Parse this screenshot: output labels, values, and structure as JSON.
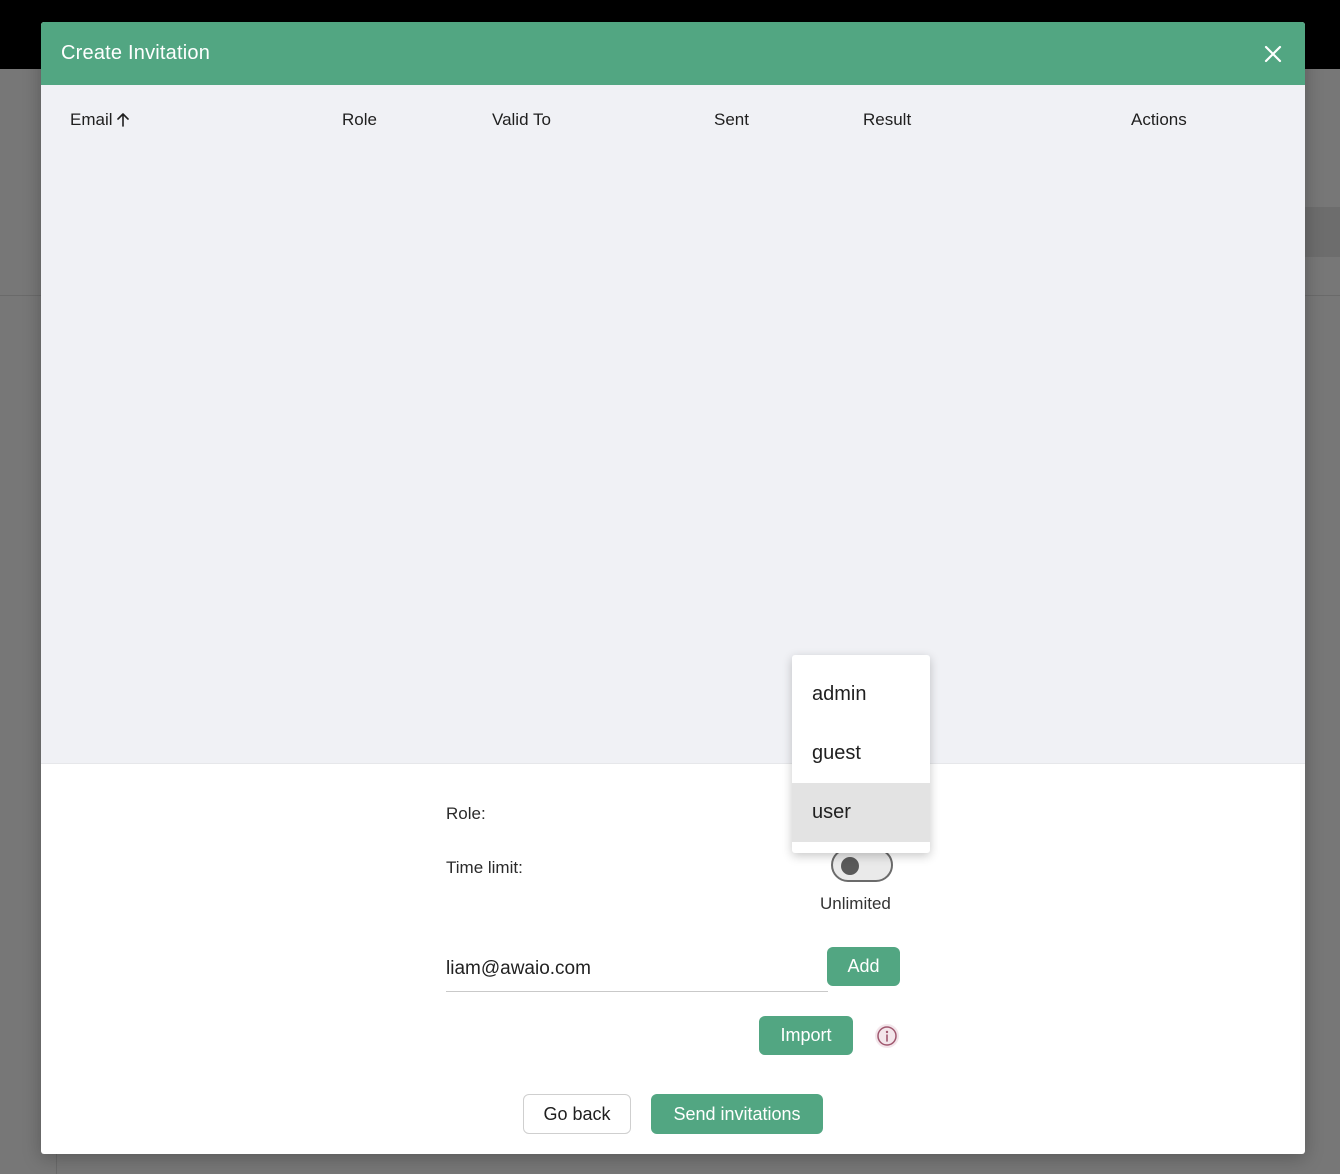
{
  "modal": {
    "title": "Create Invitation"
  },
  "table": {
    "columns": [
      "Email",
      "Role",
      "Valid To",
      "Sent",
      "Result",
      "Actions"
    ],
    "sort_column": "Email",
    "sort_direction": "ascending",
    "rows": []
  },
  "form": {
    "role_label": "Role:",
    "time_limit_label": "Time limit:",
    "time_limit_enabled": false,
    "time_limit_state": "Unlimited",
    "email_value": "liam@awaio.com",
    "add_label": "Add",
    "import_label": "Import"
  },
  "role_dropdown": {
    "options": [
      "admin",
      "guest",
      "user"
    ],
    "highlighted": "user"
  },
  "footer": {
    "go_back_label": "Go back",
    "send_label": "Send invitations"
  },
  "colors": {
    "accent": "#52a682",
    "table_bg": "#f0f1f5",
    "backdrop": "#777777",
    "info_icon": "#b05a7a"
  }
}
